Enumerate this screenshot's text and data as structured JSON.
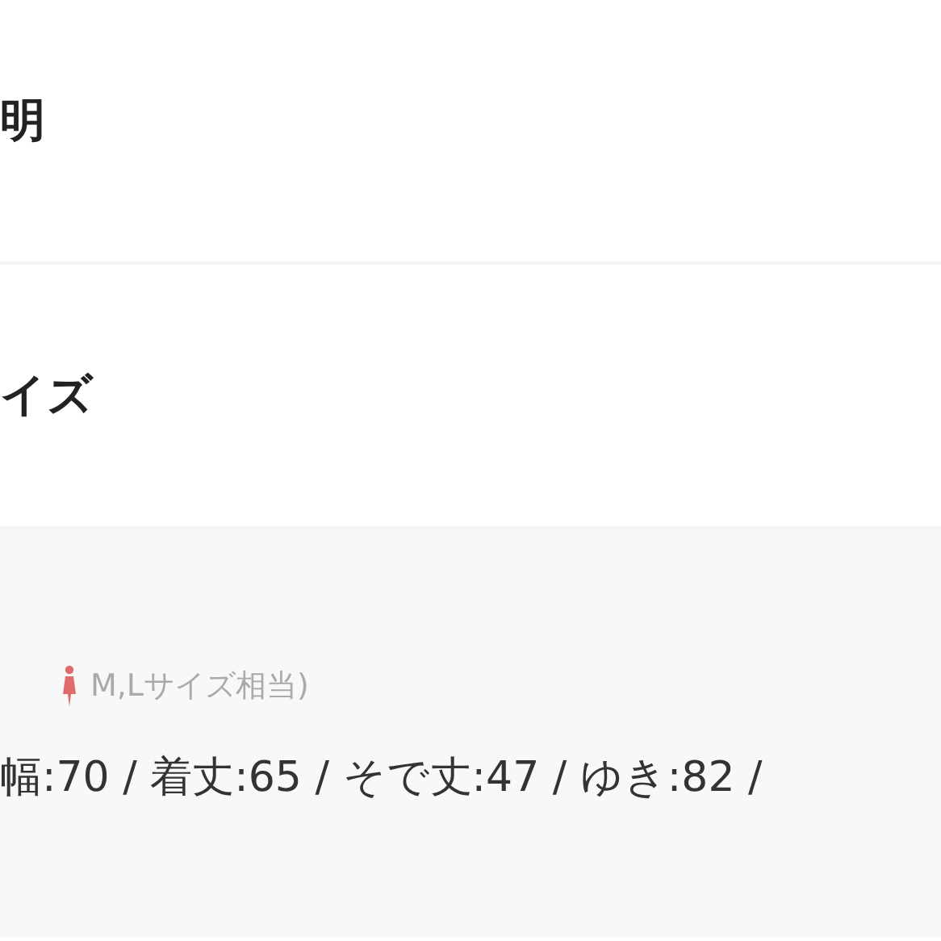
{
  "sections": [
    {
      "title": "明"
    },
    {
      "title": "イズ"
    }
  ],
  "size_note": {
    "text": "M,Lサイズ相当)"
  },
  "measurements": "幅:70 / 着丈:65 / そで丈:47 / ゆき:82 /"
}
